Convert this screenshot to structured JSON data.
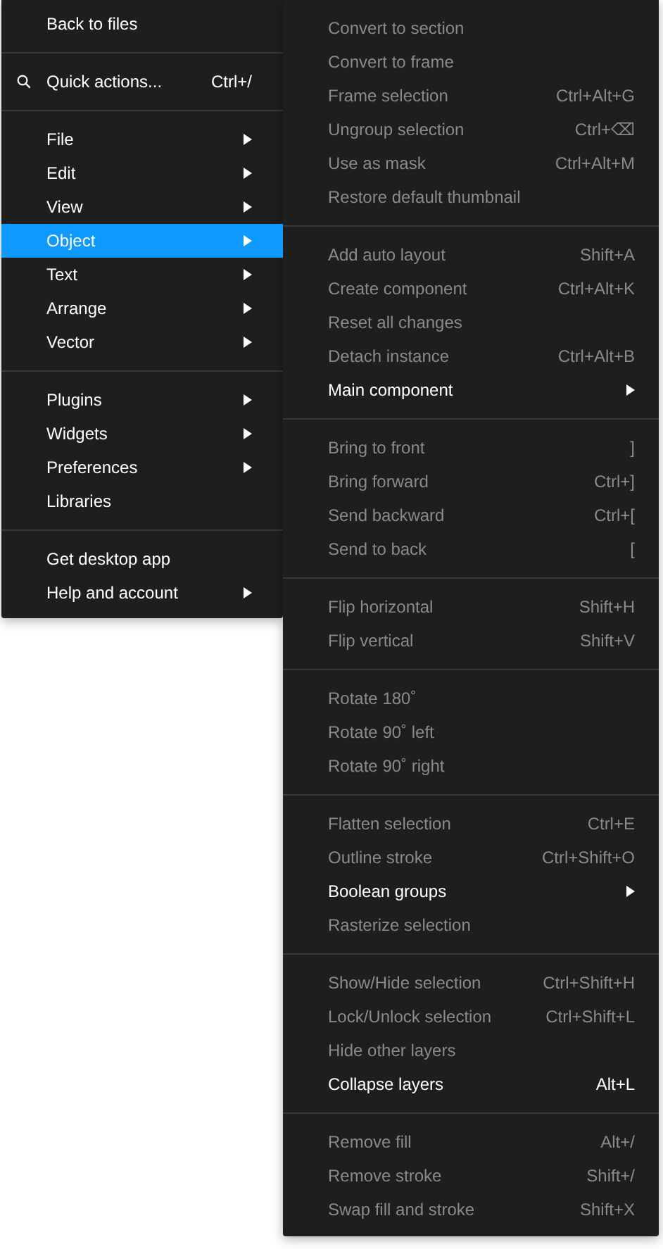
{
  "main_menu": {
    "sections": [
      {
        "items": [
          {
            "label": "Back to files",
            "kind": "plain",
            "has_submenu": false,
            "selected": false
          }
        ]
      },
      {
        "items": [
          {
            "label": "Quick actions...",
            "kind": "search",
            "shortcut": "Ctrl+/",
            "has_submenu": false,
            "selected": false
          }
        ]
      },
      {
        "items": [
          {
            "label": "File",
            "kind": "plain",
            "has_submenu": true,
            "selected": false
          },
          {
            "label": "Edit",
            "kind": "plain",
            "has_submenu": true,
            "selected": false
          },
          {
            "label": "View",
            "kind": "plain",
            "has_submenu": true,
            "selected": false
          },
          {
            "label": "Object",
            "kind": "plain",
            "has_submenu": true,
            "selected": true
          },
          {
            "label": "Text",
            "kind": "plain",
            "has_submenu": true,
            "selected": false
          },
          {
            "label": "Arrange",
            "kind": "plain",
            "has_submenu": true,
            "selected": false
          },
          {
            "label": "Vector",
            "kind": "plain",
            "has_submenu": true,
            "selected": false
          }
        ]
      },
      {
        "items": [
          {
            "label": "Plugins",
            "kind": "plain",
            "has_submenu": true,
            "selected": false
          },
          {
            "label": "Widgets",
            "kind": "plain",
            "has_submenu": true,
            "selected": false
          },
          {
            "label": "Preferences",
            "kind": "plain",
            "has_submenu": true,
            "selected": false
          },
          {
            "label": "Libraries",
            "kind": "plain",
            "has_submenu": false,
            "selected": false
          }
        ]
      },
      {
        "items": [
          {
            "label": "Get desktop app",
            "kind": "plain",
            "has_submenu": false,
            "selected": false
          },
          {
            "label": "Help and account",
            "kind": "plain",
            "has_submenu": true,
            "selected": false
          }
        ]
      }
    ]
  },
  "object_submenu": {
    "sections": [
      {
        "items": [
          {
            "label": "Convert to section",
            "disabled": true,
            "has_submenu": false
          },
          {
            "label": "Convert to frame",
            "disabled": true,
            "has_submenu": false
          },
          {
            "label": "Frame selection",
            "shortcut": "Ctrl+Alt+G",
            "disabled": true,
            "has_submenu": false
          },
          {
            "label": "Ungroup selection",
            "shortcut": "Ctrl+⌫",
            "disabled": true,
            "has_submenu": false
          },
          {
            "label": "Use as mask",
            "shortcut": "Ctrl+Alt+M",
            "disabled": true,
            "has_submenu": false
          },
          {
            "label": "Restore default thumbnail",
            "disabled": true,
            "has_submenu": false
          }
        ]
      },
      {
        "items": [
          {
            "label": "Add auto layout",
            "shortcut": "Shift+A",
            "disabled": true,
            "has_submenu": false
          },
          {
            "label": "Create component",
            "shortcut": "Ctrl+Alt+K",
            "disabled": true,
            "has_submenu": false
          },
          {
            "label": "Reset all changes",
            "disabled": true,
            "has_submenu": false
          },
          {
            "label": "Detach instance",
            "shortcut": "Ctrl+Alt+B",
            "disabled": true,
            "has_submenu": false
          },
          {
            "label": "Main component",
            "disabled": false,
            "has_submenu": true
          }
        ]
      },
      {
        "items": [
          {
            "label": "Bring to front",
            "shortcut": "]",
            "disabled": true,
            "has_submenu": false
          },
          {
            "label": "Bring forward",
            "shortcut": "Ctrl+]",
            "disabled": true,
            "has_submenu": false
          },
          {
            "label": "Send backward",
            "shortcut": "Ctrl+[",
            "disabled": true,
            "has_submenu": false
          },
          {
            "label": "Send to back",
            "shortcut": "[",
            "disabled": true,
            "has_submenu": false
          }
        ]
      },
      {
        "items": [
          {
            "label": "Flip horizontal",
            "shortcut": "Shift+H",
            "disabled": true,
            "has_submenu": false
          },
          {
            "label": "Flip vertical",
            "shortcut": "Shift+V",
            "disabled": true,
            "has_submenu": false
          }
        ]
      },
      {
        "items": [
          {
            "label": "Rotate 180˚",
            "disabled": true,
            "has_submenu": false
          },
          {
            "label": "Rotate 90˚ left",
            "disabled": true,
            "has_submenu": false
          },
          {
            "label": "Rotate 90˚ right",
            "disabled": true,
            "has_submenu": false
          }
        ]
      },
      {
        "items": [
          {
            "label": "Flatten selection",
            "shortcut": "Ctrl+E",
            "disabled": true,
            "has_submenu": false
          },
          {
            "label": "Outline stroke",
            "shortcut": "Ctrl+Shift+O",
            "disabled": true,
            "has_submenu": false
          },
          {
            "label": "Boolean groups",
            "disabled": false,
            "has_submenu": true
          },
          {
            "label": "Rasterize selection",
            "disabled": true,
            "has_submenu": false
          }
        ]
      },
      {
        "items": [
          {
            "label": "Show/Hide selection",
            "shortcut": "Ctrl+Shift+H",
            "disabled": true,
            "has_submenu": false
          },
          {
            "label": "Lock/Unlock selection",
            "shortcut": "Ctrl+Shift+L",
            "disabled": true,
            "has_submenu": false
          },
          {
            "label": "Hide other layers",
            "disabled": true,
            "has_submenu": false
          },
          {
            "label": "Collapse layers",
            "shortcut": "Alt+L",
            "disabled": false,
            "has_submenu": false
          }
        ]
      },
      {
        "items": [
          {
            "label": "Remove fill",
            "shortcut": "Alt+/",
            "disabled": true,
            "has_submenu": false
          },
          {
            "label": "Remove stroke",
            "shortcut": "Shift+/",
            "disabled": true,
            "has_submenu": false
          },
          {
            "label": "Swap fill and stroke",
            "shortcut": "Shift+X",
            "disabled": true,
            "has_submenu": false
          }
        ]
      }
    ]
  }
}
